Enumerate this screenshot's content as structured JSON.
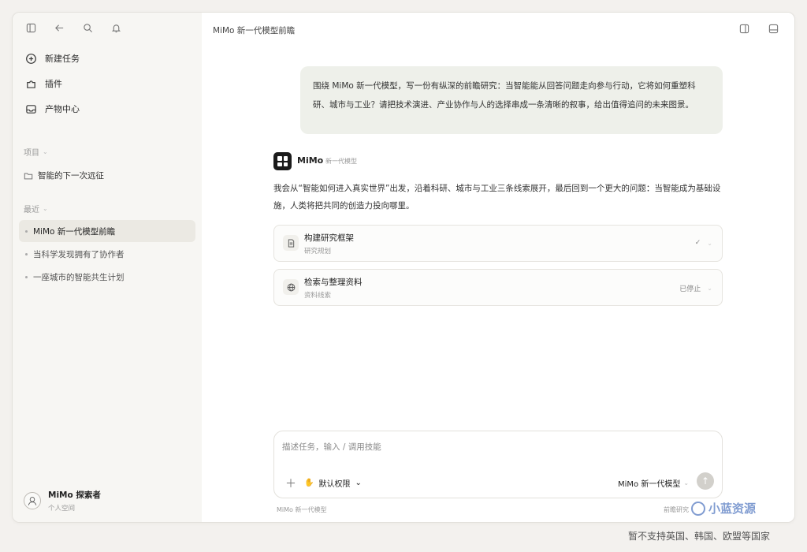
{
  "sidebar": {
    "nav": [
      {
        "label": "新建任务",
        "icon": "new-task-icon"
      },
      {
        "label": "插件",
        "icon": "plugin-icon"
      },
      {
        "label": "产物中心",
        "icon": "inbox-icon"
      }
    ],
    "projects_title": "项目",
    "projects": [
      "智能的下一次远征"
    ],
    "recent_title": "最近",
    "recent": [
      "MiMo 新一代模型前瞻",
      "当科学发现拥有了协作者",
      "一座城市的智能共生计划"
    ],
    "user": {
      "name": "MiMo 探索者",
      "sub": "个人空间"
    }
  },
  "main": {
    "title": "MiMo 新一代模型前瞻",
    "user_message": "围绕 MiMo 新一代模型，写一份有纵深的前瞻研究：当智能能从回答问题走向参与行动，它将如何重塑科研、城市与工业？请把技术演进、产业协作与人的选择串成一条清晰的叙事，给出值得追问的未来图景。",
    "assistant": {
      "name": "MiMo",
      "model": "新一代模型",
      "reply": "我会从“智能如何进入真实世界”出发，沿着科研、城市与工业三条线索展开，最后回到一个更大的问题：当智能成为基础设施，人类将把共同的创造力投向哪里。"
    },
    "steps": [
      {
        "title": "构建研究框架",
        "sub": "研究规划",
        "status": "✓"
      },
      {
        "title": "检索与整理资料",
        "sub": "资料线索",
        "status": "已停止"
      }
    ],
    "composer": {
      "placeholder": "描述任务，输入 / 调用技能",
      "permission": "默认权限",
      "model": "MiMo 新一代模型"
    },
    "footer_left": "MiMo 新一代模型",
    "footer_right": "前瞻研究"
  },
  "watermark": "小蓝资源",
  "caption": "暂不支持英国、韩国、欧盟等国家"
}
